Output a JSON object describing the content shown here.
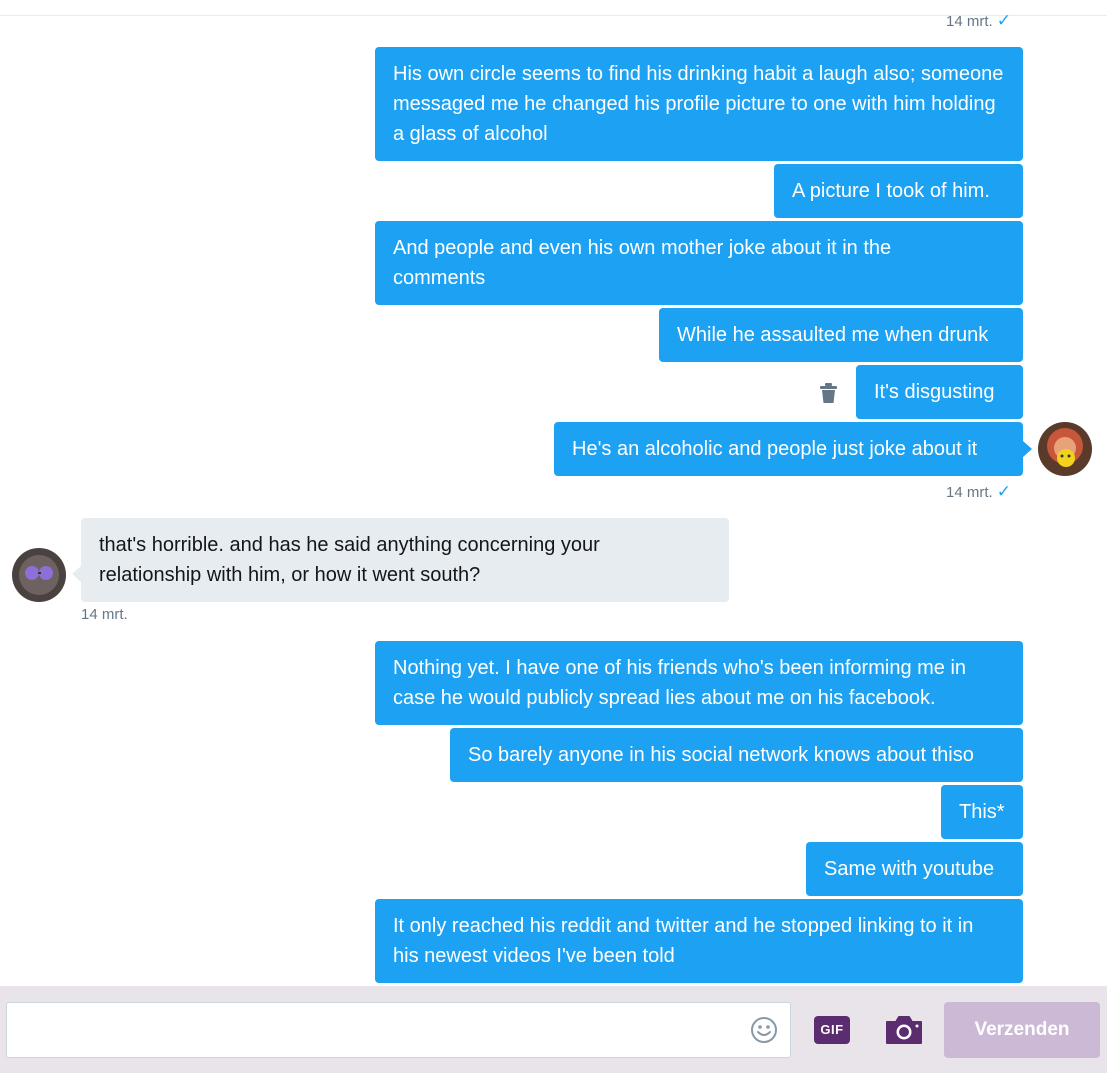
{
  "conversation": {
    "timestamp_top": "14 mrt.",
    "timestamp_sent_1": "14 mrt.",
    "timestamp_received": "14 mrt.",
    "messages_block_1": [
      "His own circle seems to find his drinking habit a laugh also; someone messaged me he changed his profile picture to one with him holding a glass of alcohol",
      "A picture I took of him.",
      "And people and even his own mother joke about it in the comments",
      "While he assaulted me when drunk",
      "It's disgusting",
      "He's an alcoholic and people just joke about it"
    ],
    "received_message": "that's horrible. and has he said anything concerning your relationship with him, or how it went south?",
    "messages_block_2": [
      "Nothing yet. I have one of his friends who's been informing me in case he would publicly spread lies about me on his facebook.",
      "So barely anyone in his social network knows about thiso",
      "This*",
      "Same with youtube",
      "It only reached his reddit and twitter and he stopped linking to it in his newest videos I've been told"
    ]
  },
  "icons": {
    "read_check": "checkmark-icon",
    "delete": "trash-icon",
    "emoji": "smiley-icon",
    "gif": "gif-icon",
    "camera": "camera-icon"
  },
  "composer": {
    "input_value": "",
    "gif_label": "GIF",
    "send_label": "Verzenden"
  },
  "colors": {
    "sent_bubble": "#1da1f2",
    "received_bubble": "#e6ecf0",
    "send_button_disabled": "#cbb9d6",
    "gif_button": "#5b2c6f"
  }
}
